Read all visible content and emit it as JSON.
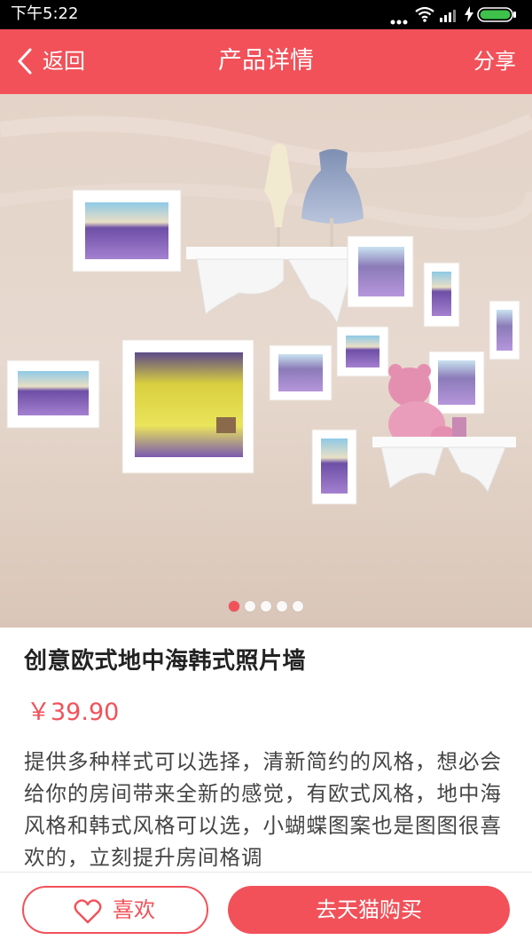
{
  "status_bar": {
    "time": "下午5:22",
    "icons": [
      "more-dots-icon",
      "wifi-icon",
      "signal-icon",
      "charging-icon",
      "battery-icon"
    ]
  },
  "header": {
    "back_label": "返回",
    "title": "产品详情",
    "share_label": "分享"
  },
  "carousel": {
    "total_slides": 5,
    "active_slide": 1
  },
  "product": {
    "name": "创意欧式地中海韩式照片墙",
    "price": "￥39.90",
    "description": "提供多种样式可以选择，清新简约的风格，想必会给你的房间带来全新的感觉，有欧式风格，地中海风格和韩式风格可以选，小蝴蝶图案也是图图很喜欢的，立刻提升房间格调"
  },
  "bottom_bar": {
    "like_label": "喜欢",
    "buy_label": "去天猫购买"
  },
  "colors": {
    "accent": "#f25159",
    "status_bar_bg": "#000000",
    "text_dark": "#222222",
    "text_body": "#444444"
  }
}
